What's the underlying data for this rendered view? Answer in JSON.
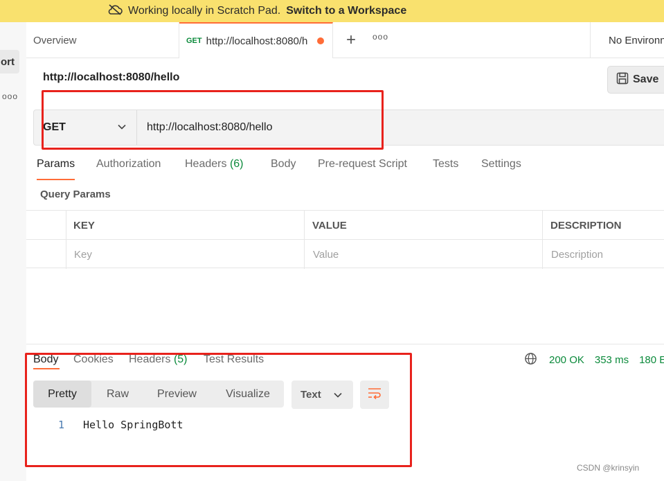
{
  "banner": {
    "message": "Working locally in Scratch Pad.",
    "link": "Switch to a Workspace",
    "icon": "cloud-off-icon"
  },
  "sidebar": {
    "import_label": "ort",
    "more_icon": "ellipsis-icon"
  },
  "tabs": {
    "overview": "Overview",
    "active": {
      "method": "GET",
      "url": "http://localhost:8080/h"
    },
    "new_tab_icon": "plus-icon",
    "more_icon": "ellipsis-icon",
    "environment": "No Environn"
  },
  "request": {
    "title": "http://localhost:8080/hello",
    "save_label": "Save",
    "method": "GET",
    "url": "http://localhost:8080/hello"
  },
  "request_tabs": {
    "params": "Params",
    "authorization": "Authorization",
    "headers": "Headers",
    "headers_count": "(6)",
    "body": "Body",
    "prerequest": "Pre-request Script",
    "tests": "Tests",
    "settings": "Settings"
  },
  "query_params": {
    "title": "Query Params",
    "headers": [
      "KEY",
      "VALUE",
      "DESCRIPTION"
    ],
    "placeholders": [
      "Key",
      "Value",
      "Description"
    ]
  },
  "response": {
    "tabs": {
      "body": "Body",
      "cookies": "Cookies",
      "headers": "Headers",
      "headers_count": "(5)",
      "test_results": "Test Results"
    },
    "status": "200 OK",
    "time": "353 ms",
    "size": "180 E",
    "view_modes": [
      "Pretty",
      "Raw",
      "Preview",
      "Visualize"
    ],
    "format": "Text",
    "lines": [
      {
        "num": "1",
        "text": "Hello SpringBott"
      }
    ]
  },
  "colors": {
    "accent": "#ff6c37",
    "success": "#0b8a3b",
    "annotation": "#e8221c",
    "banner": "#f9e16e"
  },
  "watermark": "CSDN @krinsyin"
}
